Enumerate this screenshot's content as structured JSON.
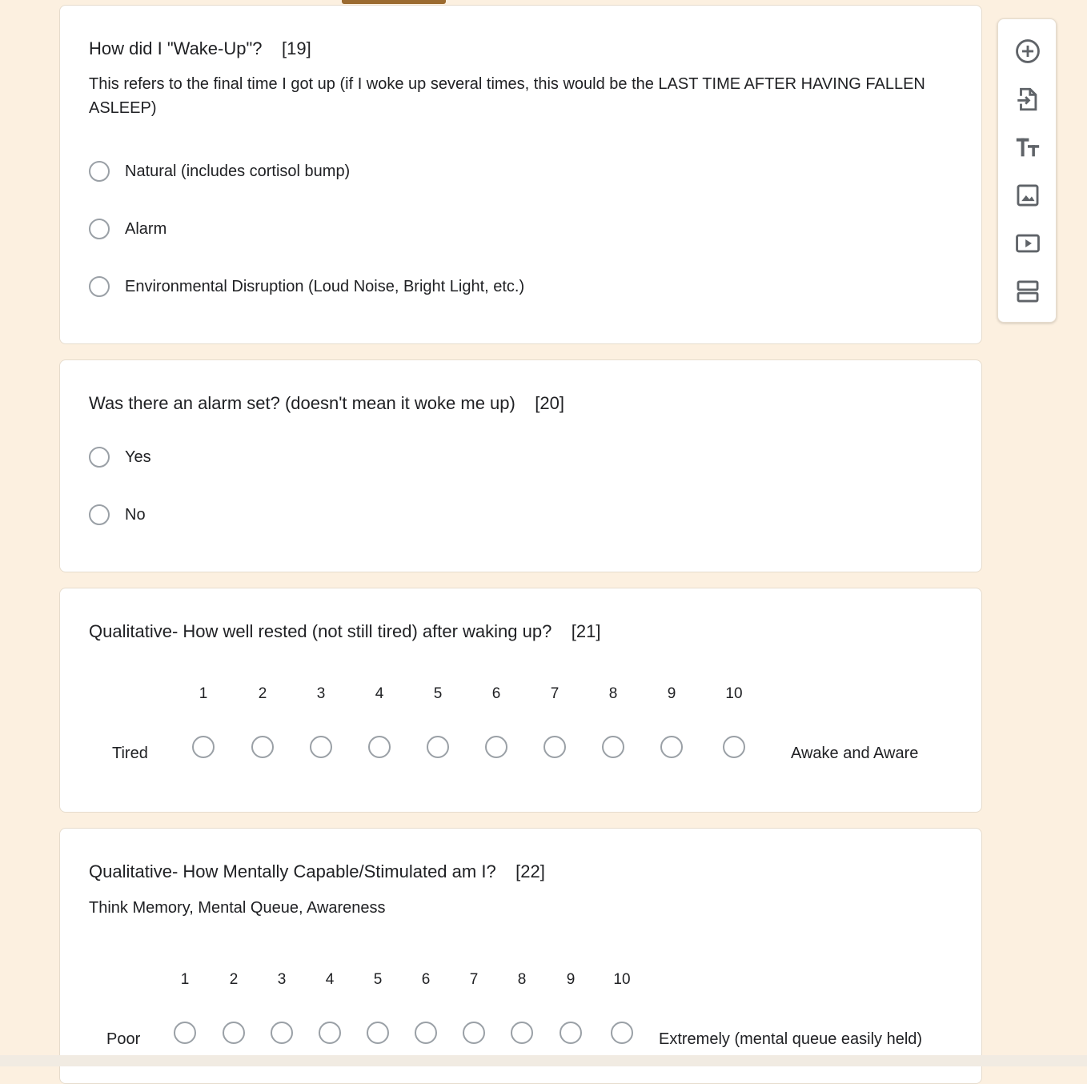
{
  "questions": [
    {
      "title": "How did I \"Wake-Up\"?    [19]",
      "description": "This refers to the final time I got up (if I woke up several times, this would be the LAST TIME AFTER HAVING FALLEN ASLEEP)",
      "options": [
        "Natural (includes cortisol bump)",
        "Alarm",
        "Environmental Disruption (Loud Noise, Bright Light, etc.)"
      ]
    },
    {
      "title": "Was there an alarm set? (doesn't mean it woke me up)    [20]",
      "options": [
        "Yes",
        "No"
      ]
    },
    {
      "title": "Qualitative- How well rested (not still tired) after waking up?    [21]",
      "scale": [
        "1",
        "2",
        "3",
        "4",
        "5",
        "6",
        "7",
        "8",
        "9",
        "10"
      ],
      "low_label": "Tired",
      "high_label": "Awake and Aware"
    },
    {
      "title": "Qualitative- How Mentally Capable/Stimulated am I?    [22]",
      "description": "Think Memory, Mental Queue, Awareness",
      "scale": [
        "1",
        "2",
        "3",
        "4",
        "5",
        "6",
        "7",
        "8",
        "9",
        "10"
      ],
      "low_label": "Poor",
      "high_label": "Extremely (mental queue easily held)"
    }
  ],
  "toolbar": {
    "icons": [
      "add-question-icon",
      "import-questions-icon",
      "add-title-icon",
      "add-image-icon",
      "add-video-icon",
      "add-section-icon"
    ]
  },
  "colors": {
    "page_bg": "#fcf0e0",
    "accent": "#9c6b30",
    "radio_border": "#9aa0a6"
  }
}
